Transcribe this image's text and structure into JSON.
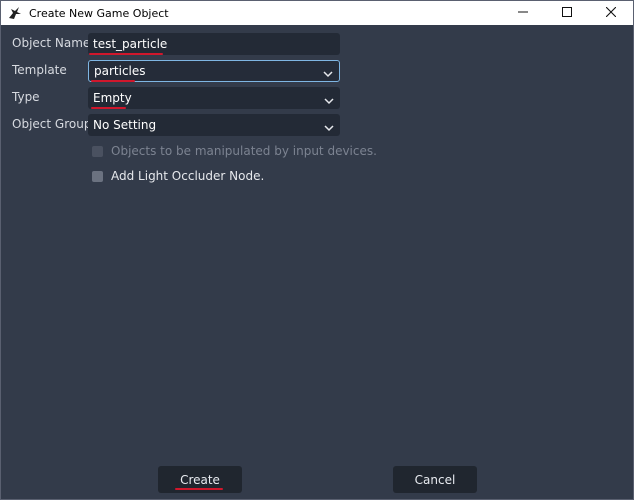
{
  "window": {
    "title": "Create New Game Object",
    "controls": {
      "minimize": "—",
      "maximize": "☐",
      "close": "✕"
    }
  },
  "form": {
    "object_name_label": "Object Name",
    "object_name_value": "test_particle",
    "template_label": "Template",
    "template_value": "particles",
    "type_label": "Type",
    "type_value": "Empty",
    "object_group_label": "Object Group",
    "object_group_value": "No Setting",
    "checkbox_input_devices": "Objects to be manipulated by input devices.",
    "checkbox_input_devices_enabled": false,
    "checkbox_light_occluder": "Add Light Occluder Node.",
    "checkbox_light_occluder_enabled": true
  },
  "buttons": {
    "create": "Create",
    "cancel": "Cancel"
  },
  "colors": {
    "background": "#333b4a",
    "field_bg": "#232a36",
    "focus_border": "#7fb6e3",
    "annotation_underline": "#d0172c"
  },
  "icons": {
    "app": "godot-logo-icon",
    "dropdown": "chevron-down-icon"
  }
}
